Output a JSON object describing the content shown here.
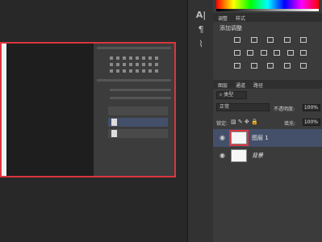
{
  "canvas": {
    "mini_tab": "调整"
  },
  "adjustments": {
    "tab_adjust": "调整",
    "tab_style": "样式",
    "title": "添加调整"
  },
  "layers": {
    "tab_layers": "图层",
    "tab_channels": "通道",
    "tab_paths": "路径",
    "kind_filter": "类型",
    "blend_mode": "正常",
    "opacity_label": "不透明度:",
    "opacity_value": "100%",
    "lock_label": "锁定:",
    "fill_label": "填充:",
    "fill_value": "100%",
    "items": [
      {
        "name": "图层 1",
        "selected": true
      },
      {
        "name": "背景",
        "selected": false
      }
    ]
  },
  "tools": {
    "icons": [
      "text-tool-icon",
      "paragraph-icon",
      "brush-icon"
    ]
  },
  "colors": {
    "accent_red": "#d9353d",
    "selected_layer": "#44506a"
  }
}
